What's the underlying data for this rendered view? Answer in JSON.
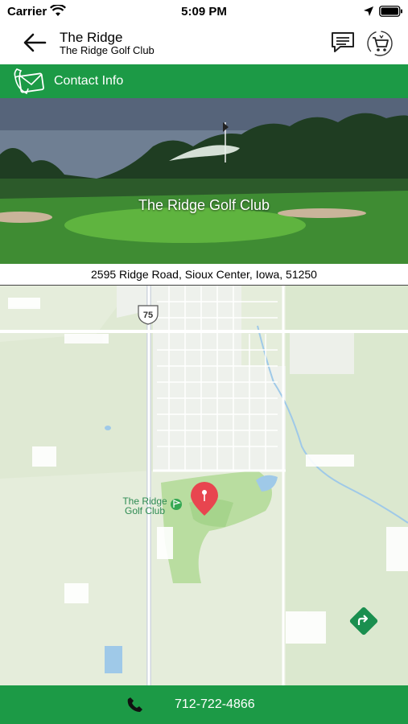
{
  "status_bar": {
    "carrier": "Carrier",
    "time": "5:09 PM"
  },
  "header": {
    "title": "The Ridge",
    "subtitle": "The Ridge Golf Club"
  },
  "contact_bar": {
    "label": "Contact Info"
  },
  "hero": {
    "name": "The Ridge Golf Club"
  },
  "address": "2595 Ridge Road, Sioux Center, Iowa, 51250",
  "map": {
    "place_label_line1": "The Ridge",
    "place_label_line2": "Golf Club",
    "highway": "75"
  },
  "phone": "712-722-4866",
  "colors": {
    "brand_green": "#1c9a46",
    "pin_red": "#e8454f",
    "directions_green": "#1a8f4f"
  },
  "icons": [
    "wifi-icon",
    "location-arrow-icon",
    "battery-icon",
    "back-arrow-icon",
    "chat-icon",
    "cart-icon",
    "envelope-phone-icon",
    "map-pin-icon",
    "directions-icon",
    "phone-icon"
  ]
}
